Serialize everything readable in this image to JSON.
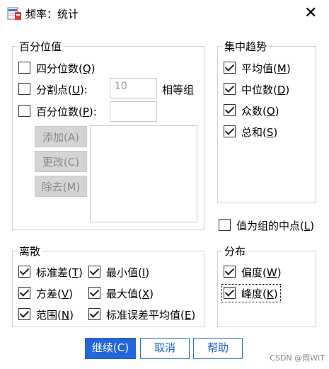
{
  "window": {
    "title": "频率：统计",
    "close": "✕"
  },
  "percentile": {
    "legend": "百分位值",
    "quartiles": {
      "label": "四分位数(",
      "key": "Q",
      "end": ")",
      "checked": false
    },
    "cut_points": {
      "label": "分割点(",
      "key": "U",
      "end": "):",
      "checked": false,
      "value": "10",
      "suffix": "相等组"
    },
    "percentiles": {
      "label": "百分位数(",
      "key": "P",
      "end": "):",
      "checked": false,
      "value": ""
    },
    "buttons": {
      "add": "添加(A)",
      "change": "更改(C)",
      "remove": "除去(M)"
    }
  },
  "central": {
    "legend": "集中趋势",
    "items": [
      {
        "label": "平均值(",
        "key": "M",
        "end": ")",
        "checked": true
      },
      {
        "label": "中位数(",
        "key": "D",
        "end": ")",
        "checked": true
      },
      {
        "label": "众数(",
        "key": "O",
        "end": ")",
        "checked": true
      },
      {
        "label": "总和(",
        "key": "S",
        "end": ")",
        "checked": true
      }
    ]
  },
  "midpoint": {
    "label": "值为组的中点(",
    "key": "L",
    "end": ")",
    "checked": false
  },
  "dispersion": {
    "legend": "离散",
    "items": [
      {
        "label": "标准差(",
        "key": "T",
        "end": ")",
        "checked": true
      },
      {
        "label": "最小值(",
        "key": "I",
        "end": ")",
        "checked": true
      },
      {
        "label": "方差(",
        "key": "V",
        "end": ")",
        "checked": true
      },
      {
        "label": "最大值(",
        "key": "X",
        "end": ")",
        "checked": true
      },
      {
        "label": "范围(",
        "key": "N",
        "end": ")",
        "checked": true
      },
      {
        "label": "标准误差平均值(",
        "key": "E",
        "end": ")",
        "checked": true
      }
    ]
  },
  "distribution": {
    "legend": "分布",
    "items": [
      {
        "label": "偏度(",
        "key": "W",
        "end": ")",
        "checked": true
      },
      {
        "label": "峰度(",
        "key": "K",
        "end": ")",
        "checked": true
      }
    ]
  },
  "footer": {
    "continue": "继续(C)",
    "cancel": "取消",
    "help": "帮助"
  },
  "watermark": "CSDN @雨WIT"
}
